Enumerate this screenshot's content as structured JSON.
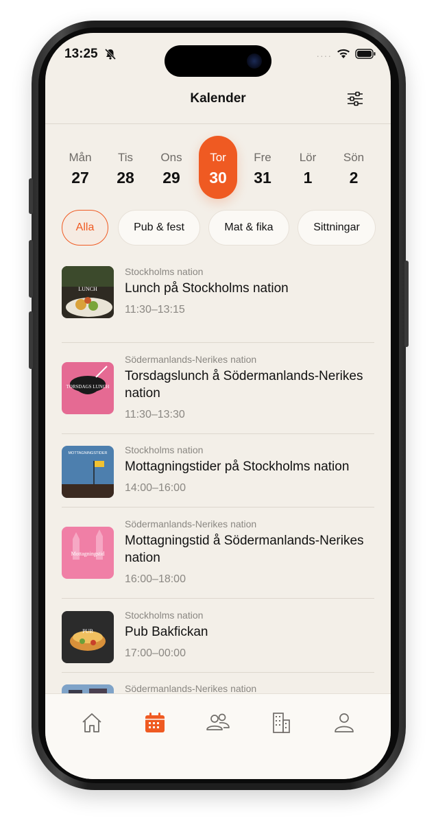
{
  "status_bar": {
    "time": "13:25",
    "signal": "····"
  },
  "header": {
    "title": "Kalender"
  },
  "days": [
    {
      "name": "Mån",
      "num": "27",
      "selected": false
    },
    {
      "name": "Tis",
      "num": "28",
      "selected": false
    },
    {
      "name": "Ons",
      "num": "29",
      "selected": false
    },
    {
      "name": "Tor",
      "num": "30",
      "selected": true
    },
    {
      "name": "Fre",
      "num": "31",
      "selected": false
    },
    {
      "name": "Lör",
      "num": "1",
      "selected": false
    },
    {
      "name": "Sön",
      "num": "2",
      "selected": false
    }
  ],
  "filters": [
    {
      "label": "Alla",
      "active": true
    },
    {
      "label": "Pub & fest",
      "active": false
    },
    {
      "label": "Mat & fika",
      "active": false
    },
    {
      "label": "Sittningar",
      "active": false
    }
  ],
  "events": [
    {
      "nation": "Stockholms nation",
      "title": "Lunch på Stockholms nation",
      "time": "11:30–13:15",
      "thumb_text": "LUNCH"
    },
    {
      "nation": "Södermanlands-Nerikes nation",
      "title": "Torsdagslunch å Södermanlands-Nerikes nation",
      "time": "11:30–13:30",
      "thumb_text": "TORSDAGS LUNCH"
    },
    {
      "nation": "Stockholms nation",
      "title": "Mottagningstider på Stockholms nation",
      "time": "14:00–16:00",
      "thumb_text": "MOTTAGNINGSTIDER"
    },
    {
      "nation": "Södermanlands-Nerikes nation",
      "title": "Mottagningstid å Södermanlands-Nerikes nation",
      "time": "16:00–18:00",
      "thumb_text": "Mottagningstid"
    },
    {
      "nation": "Stockholms nation",
      "title": "Pub Bakfickan",
      "time": "17:00–00:00",
      "thumb_text": "PUB"
    },
    {
      "nation": "Södermanlands-Nerikes nation",
      "title": "",
      "time": "",
      "thumb_text": ""
    }
  ],
  "tabs": [
    {
      "name": "home",
      "icon": "home-icon",
      "active": false
    },
    {
      "name": "calendar",
      "icon": "calendar-icon",
      "active": true
    },
    {
      "name": "people",
      "icon": "people-icon",
      "active": false
    },
    {
      "name": "buildings",
      "icon": "building-icon",
      "active": false
    },
    {
      "name": "profile",
      "icon": "person-icon",
      "active": false
    }
  ],
  "colors": {
    "accent": "#ef5a22",
    "background": "#f3efe8",
    "muted": "#8a8782"
  }
}
